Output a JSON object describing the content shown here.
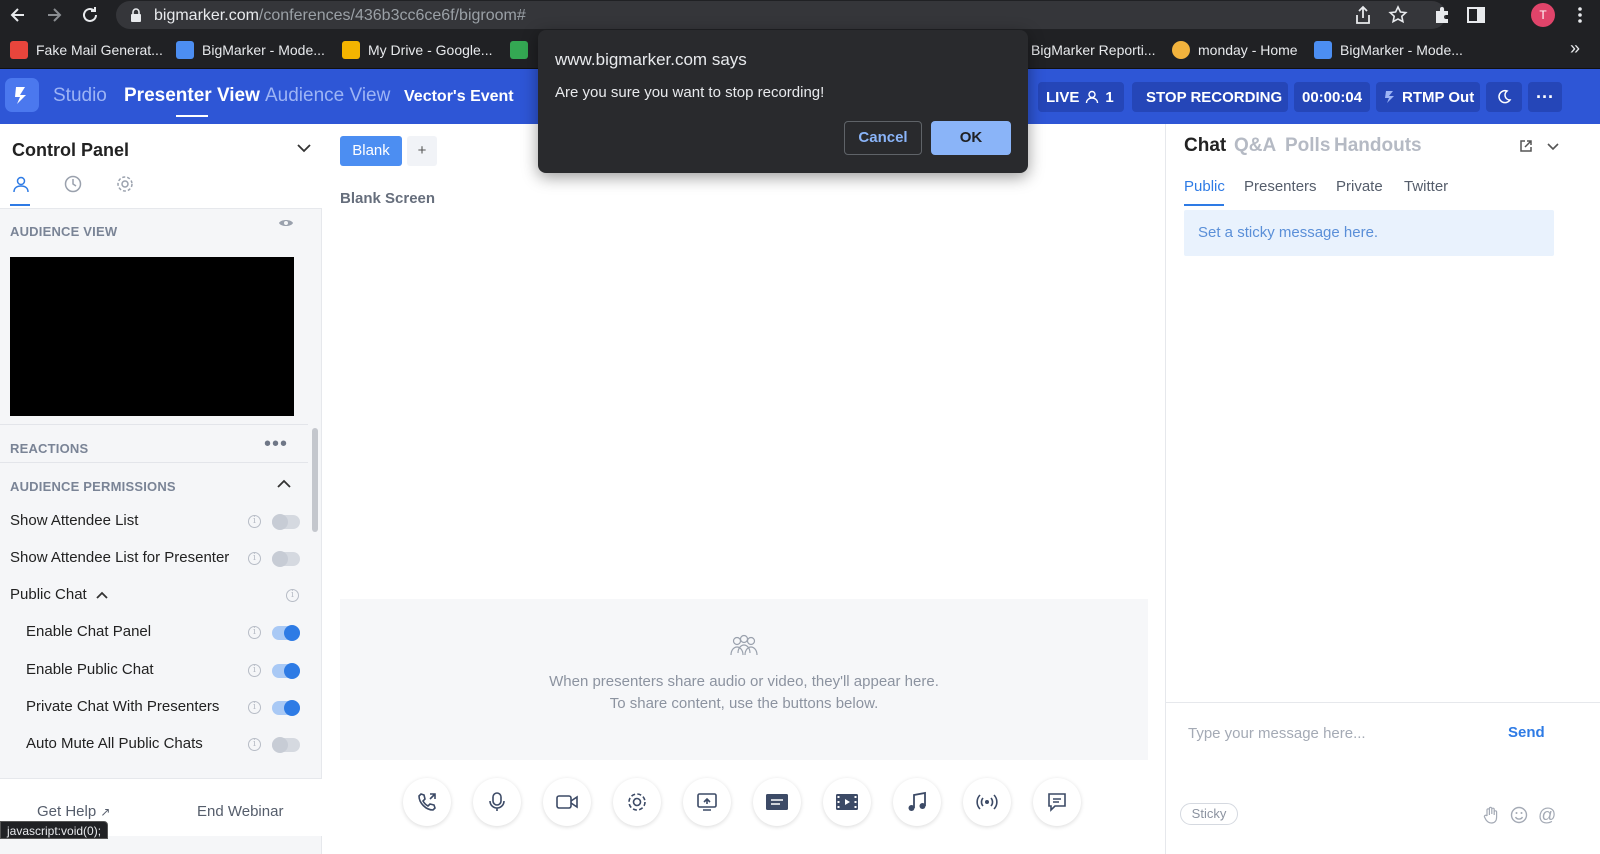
{
  "browser": {
    "url_host": "bigmarker.com",
    "url_path": "/conferences/436b3cc6ce6f/bigroom#",
    "profile_initial": "T",
    "more_chevron": "»",
    "bookmarks": [
      {
        "label": "Fake Mail Generat...",
        "color": "#e8453c"
      },
      {
        "label": "BigMarker - Mode...",
        "color": "#4c8ef2"
      },
      {
        "label": "My Drive - Google...",
        "color": "#f4b400"
      },
      {
        "label": "",
        "color": "#34a853"
      },
      {
        "label": "BigMarker Reporti...",
        "color": "#4c8ef2"
      },
      {
        "label": "monday - Home",
        "color": "#f2b33d"
      },
      {
        "label": "BigMarker - Mode...",
        "color": "#4c8ef2"
      }
    ]
  },
  "header": {
    "nav": [
      "Studio",
      "Presenter View",
      "Audience View",
      "Vector's Event"
    ],
    "live_label": "LIVE",
    "attendee_count": "1",
    "stop_recording": "STOP RECORDING",
    "timer": "00:00:04",
    "rtmp": "RTMP Out",
    "more": "···"
  },
  "control_panel": {
    "title": "Control Panel",
    "audience_view_label": "AUDIENCE VIEW",
    "reactions_label": "REACTIONS",
    "permissions_label": "AUDIENCE PERMISSIONS",
    "permissions": [
      {
        "label": "Show Attendee List",
        "on": false,
        "indent": false
      },
      {
        "label": "Show Attendee List for Presenter",
        "on": false,
        "indent": false
      },
      {
        "label": "Enable Chat Panel",
        "on": true,
        "indent": true
      },
      {
        "label": "Enable Public Chat",
        "on": true,
        "indent": true
      },
      {
        "label": "Private Chat With Presenters",
        "on": true,
        "indent": true
      },
      {
        "label": "Auto Mute All Public Chats",
        "on": false,
        "indent": true
      }
    ],
    "public_chat_label": "Public Chat",
    "get_help": "Get Help",
    "end_webinar": "End Webinar",
    "status_tip": "javascript:void(0);"
  },
  "stage": {
    "tab_blank": "Blank",
    "tab_add": "+",
    "blank_screen": "Blank Screen",
    "share_line1": "When presenters share audio or video, they'll appear here.",
    "share_line2": "To share content, use the buttons below."
  },
  "chat": {
    "tabs": [
      "Chat",
      "Q&A",
      "Polls",
      "Handouts"
    ],
    "subtabs": [
      "Public",
      "Presenters",
      "Private",
      "Twitter"
    ],
    "sticky_message": "Set a sticky message here.",
    "input_placeholder": "Type your message here...",
    "send": "Send",
    "sticky_button": "Sticky"
  },
  "dialog": {
    "title": "www.bigmarker.com says",
    "message": "Are you sure you want to stop recording!",
    "cancel": "Cancel",
    "ok": "OK"
  },
  "colors": {
    "header_blue": "#2e56d6",
    "accent_blue": "#2e7be5",
    "dialog_ok": "#8ab4f8"
  }
}
